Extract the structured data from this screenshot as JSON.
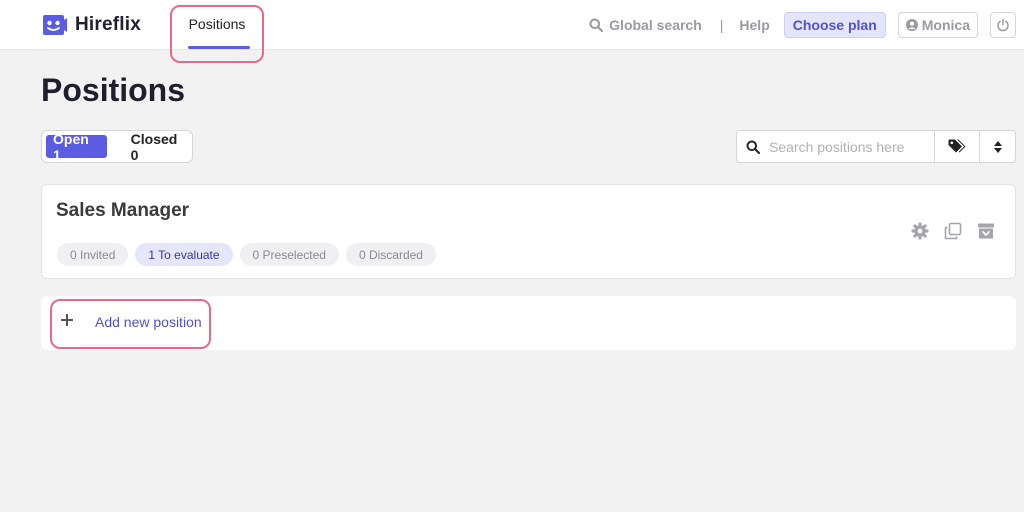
{
  "app": {
    "name": "Hireflix"
  },
  "nav": {
    "positions_tab": "Positions"
  },
  "topbar": {
    "global_search": "Global search",
    "separator": "|",
    "help": "Help",
    "choose_plan": "Choose plan",
    "user": "Monica"
  },
  "page": {
    "title": "Positions"
  },
  "filter": {
    "open": "Open 1",
    "closed": "Closed 0"
  },
  "search": {
    "placeholder": "Search positions here"
  },
  "positions": [
    {
      "title": "Sales Manager",
      "stats": {
        "invited": "0 Invited",
        "to_evaluate": "1 To evaluate",
        "preselected": "0 Preselected",
        "discarded": "0 Discarded"
      }
    }
  ],
  "add_position": {
    "label": "Add new position"
  },
  "icons": {
    "logo": "hireflix-logo-icon",
    "search": "search-icon",
    "user": "user-circle-icon",
    "power": "power-icon",
    "tags": "tags-icon",
    "sort": "sort-icon",
    "settings": "gear-icon",
    "duplicate": "duplicate-icon",
    "archive": "archive-icon",
    "plus": "plus-icon"
  },
  "colors": {
    "accent": "#5b5ce2",
    "highlight": "#e86a84",
    "background": "#f2f2f3"
  }
}
